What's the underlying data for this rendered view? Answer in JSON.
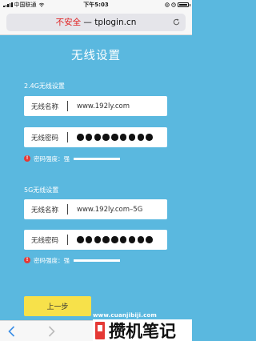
{
  "status_bar": {
    "carrier": "中国联通",
    "time": "下午5:03"
  },
  "browser": {
    "insecure_label": "不安全",
    "separator": " — ",
    "domain": "tplogin.cn"
  },
  "page": {
    "title": "无线设置"
  },
  "wifi_24g": {
    "section_label": "2.4G无线设置",
    "ssid_label": "无线名称",
    "ssid_value": "www.192ly.com",
    "password_label": "无线密码",
    "password_dot_count": 9,
    "strength_text": "密码强度：强"
  },
  "wifi_5g": {
    "section_label": "5G无线设置",
    "ssid_label": "无线名称",
    "ssid_value": "www.192ly.com–5G",
    "password_label": "无线密码",
    "password_dot_count": 9,
    "strength_text": "密码强度：强"
  },
  "actions": {
    "prev_label": "上一步"
  },
  "watermark": {
    "url": "www.cuanjibiji.com",
    "logo_text": "攒机笔记"
  },
  "colors": {
    "background": "#5ab8df",
    "prev_button": "#f7e14a",
    "insecure": "#e02020",
    "warning": "#e53935"
  },
  "icons": [
    "signal-icon",
    "wifi-icon",
    "battery-icon",
    "reload-icon",
    "warning-icon",
    "back-icon",
    "forward-icon"
  ]
}
